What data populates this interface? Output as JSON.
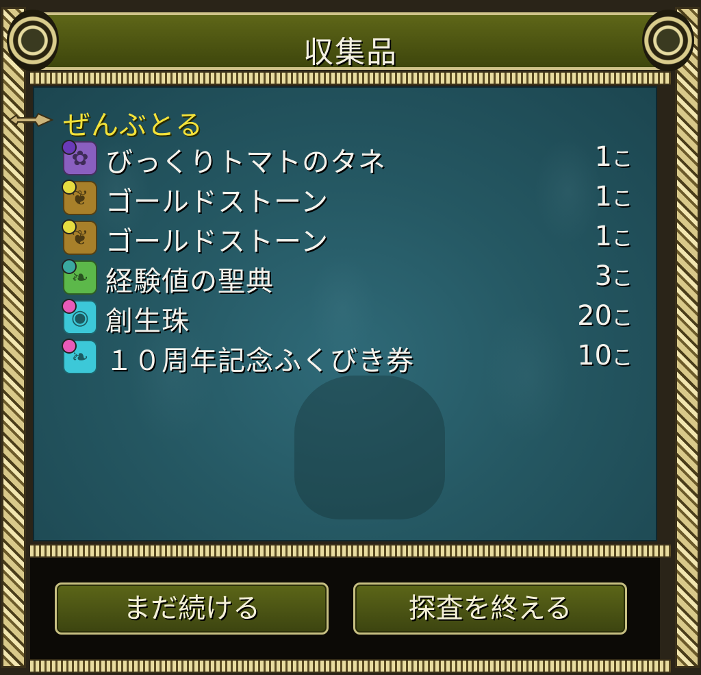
{
  "window": {
    "title": "収集品"
  },
  "list": {
    "category": "ぜんぶとる",
    "items": [
      {
        "name": "びっくりトマトのタネ",
        "qty": "1",
        "unit": "こ",
        "icon": "seed-icon",
        "icon_color": "#8a5fc0",
        "dot_color": "#6a3ab8"
      },
      {
        "name": "ゴールドストーン",
        "qty": "1",
        "unit": "こ",
        "icon": "stone-icon",
        "icon_color": "#a8802a",
        "dot_color": "#e6dc40"
      },
      {
        "name": "ゴールドストーン",
        "qty": "1",
        "unit": "こ",
        "icon": "stone-icon",
        "icon_color": "#a8802a",
        "dot_color": "#e6dc40"
      },
      {
        "name": "経験値の聖典",
        "qty": "3",
        "unit": "こ",
        "icon": "leaf-icon",
        "icon_color": "#5cb84a",
        "dot_color": "#3aa8a0"
      },
      {
        "name": "創生珠",
        "qty": "20",
        "unit": "こ",
        "icon": "orb-icon",
        "icon_color": "#3cc8d8",
        "dot_color": "#e85ab8"
      },
      {
        "name": "１０周年記念ふくびき券",
        "qty": "10",
        "unit": "こ",
        "icon": "ticket-icon",
        "icon_color": "#3cc8d8",
        "dot_color": "#e85ab8"
      }
    ]
  },
  "buttons": {
    "continue_label": "まだ続ける",
    "finish_label": "探査を終える"
  },
  "colors": {
    "category_text": "#f3e23a",
    "panel_bg": "#255863",
    "button_bg": "#4c5614",
    "frame_gold": "#d9c98a"
  }
}
